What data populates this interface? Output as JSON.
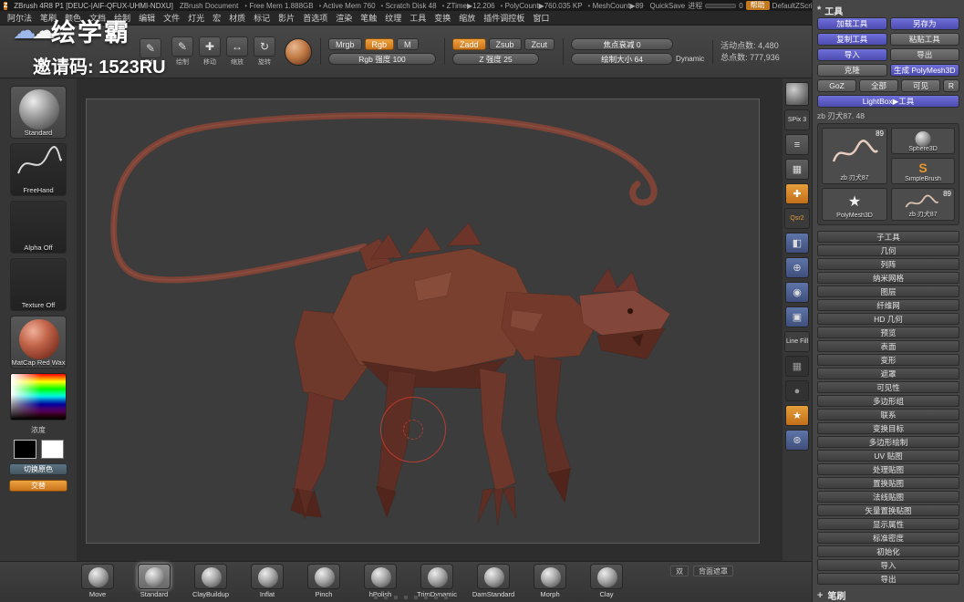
{
  "title_bar": {
    "app_icon": "Z",
    "app": "ZBrush 4R8 P1 [DEUC-|AIF-QFUX-UHMI-NDXU]",
    "doc": "ZBrush Document",
    "stats": [
      "Free Mem 1.888GB",
      "Active Mem 760",
      "Scratch Disk 48",
      "ZTime▶12.206",
      "PolyCount▶760.035 KP",
      "MeshCount▶89"
    ],
    "quicksave": "QuickSave",
    "progress_label": "进程",
    "progress_value": "0",
    "help": "帮助",
    "zscript": "DefaultZScript"
  },
  "menu_bar": {
    "items": [
      "阿尔法",
      "笔刷",
      "颜色",
      "文档",
      "绘制",
      "编辑",
      "文件",
      "灯光",
      "宏",
      "材质",
      "标记",
      "影片",
      "首选项",
      "渲染",
      "笔触",
      "纹理",
      "工具",
      "变换",
      "缩放",
      "插件调控板",
      "窗口"
    ]
  },
  "top_shelf": {
    "edit_label": "Edit",
    "edit_glyph": "✎",
    "tool_icons": [
      {
        "name": "draw-icon",
        "label": "绘制",
        "glyph": "✎"
      },
      {
        "name": "move-icon",
        "label": "移动",
        "glyph": "✚"
      },
      {
        "name": "scale-icon",
        "label": "缩放",
        "glyph": "↔"
      },
      {
        "name": "rotate-icon",
        "label": "旋转",
        "glyph": "↻"
      }
    ],
    "mrgb": "Mrgb",
    "rgb": "Rgb",
    "m": "M",
    "rgb_intensity": "Rgb 强度 100",
    "zadd": "Zadd",
    "zsub": "Zsub",
    "zcut": "Zcut",
    "z_intensity": "Z 强度 25",
    "focal_shift": "焦点衰减 0",
    "draw_size": "绘制大小 64",
    "dynamic": "Dynamic",
    "active_points": "活动点数: 4,480",
    "total_points": "总点数: 777,936"
  },
  "watermark": {
    "logo": "绘学霸",
    "invite": "邀请码: 1523RU"
  },
  "left_tray": {
    "brush": "Standard",
    "stroke": "FreeHand",
    "alpha": "Alpha Off",
    "texture": "Texture Off",
    "material": "MatCap Red Wax",
    "picker_label": "浓度",
    "switch_color": "切换原色",
    "alt": "交替"
  },
  "right_shelf": {
    "items": [
      {
        "name": "brush-thumb",
        "variant": "thumb",
        "glyph": "",
        "label": ""
      },
      {
        "name": "spix-slider",
        "variant": "text",
        "glyph": "",
        "label": "SPix 3"
      },
      {
        "name": "preferences-icon",
        "variant": "gray",
        "glyph": "≡",
        "label": ""
      },
      {
        "name": "frame-grid-icon",
        "variant": "gray",
        "glyph": "▦",
        "label": ""
      },
      {
        "name": "paint-icon",
        "variant": "orange",
        "glyph": "✚",
        "label": ""
      },
      {
        "name": "quicksketch-button",
        "variant": "orangetext",
        "glyph": "",
        "label": "Qsr2"
      },
      {
        "name": "scroll-icon",
        "variant": "blue",
        "glyph": "◧",
        "label": ""
      },
      {
        "name": "zoom-icon",
        "variant": "blue",
        "glyph": "⊕",
        "label": ""
      },
      {
        "name": "actual-size-icon",
        "variant": "blue",
        "glyph": "◉",
        "label": ""
      },
      {
        "name": "frame-icon",
        "variant": "blue",
        "glyph": "▣",
        "label": ""
      },
      {
        "name": "line-fill-button",
        "variant": "text",
        "glyph": "",
        "label": "Line Fill"
      },
      {
        "name": "grid-icon",
        "variant": "dark",
        "glyph": "▦",
        "label": ""
      },
      {
        "name": "material-icon",
        "variant": "dark",
        "glyph": "●",
        "label": ""
      },
      {
        "name": "transpose-icon",
        "variant": "orange",
        "glyph": "★",
        "label": ""
      },
      {
        "name": "gyro-icon",
        "variant": "blue",
        "glyph": "⊛",
        "label": ""
      }
    ]
  },
  "tool_panel": {
    "header": "工具",
    "load": "加载工具",
    "save_as": "另存为",
    "copy": "复制工具",
    "paste": "粘贴工具",
    "import": "导入",
    "export": "导出",
    "clone": "克隆",
    "make_polymesh": "生成 PolyMesh3D",
    "goz": "GoZ",
    "all": "全部",
    "visible": "可见",
    "r": "R",
    "lightbox": "LightBox▶工具",
    "tool_path": "zb 刃犬87. 48",
    "thumbs": {
      "current": "zb 刃犬87",
      "current_count": "89",
      "sphere": "Sphere3D",
      "simple": "SimpleBrush",
      "simple_letter": "S",
      "polymesh": "PolyMesh3D",
      "polymesh_glyph": "★",
      "second": "zb 刃犬87",
      "second_count": "89"
    },
    "sections": [
      "子工具",
      "几何",
      "列阵",
      "纳米网格",
      "图层",
      "纤维网",
      "HD 几何",
      "预览",
      "表面",
      "变形",
      "遮罩",
      "可见性",
      "多边形组",
      "联系",
      "变换目标",
      "多边形绘制",
      "UV 贴图",
      "处理贴图",
      "置换贴图",
      "法线贴图",
      "矢量置换贴图",
      "显示属性",
      "标准密度",
      "初始化",
      "导入",
      "导出"
    ],
    "brush_palette": "笔刷"
  },
  "bottom_shelf": {
    "brushes": [
      {
        "label": "Move"
      },
      {
        "label": "Standard",
        "variant": "selected"
      },
      {
        "label": "ClayBuildup"
      },
      {
        "label": "Inflat"
      },
      {
        "label": "Pinch"
      },
      {
        "label": "hPolish"
      },
      {
        "label": "TrimDynamic"
      },
      {
        "label": "DamStandard"
      },
      {
        "label": "Morph"
      },
      {
        "label": "Clay"
      }
    ],
    "dual": "双",
    "backface": "背面遮罩"
  }
}
